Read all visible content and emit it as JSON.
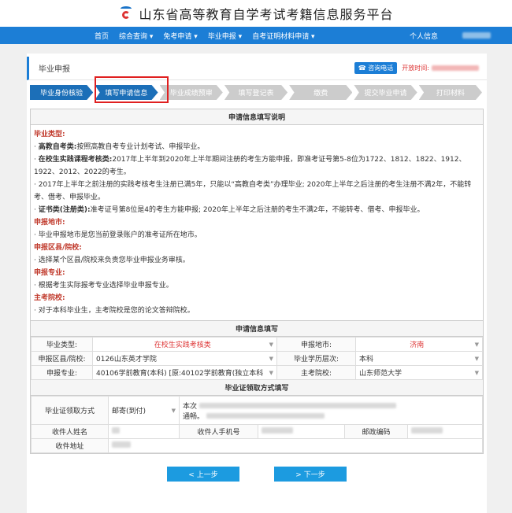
{
  "site": {
    "title": "山东省高等教育自学考试考籍信息服务平台"
  },
  "nav": {
    "items": [
      "首页",
      "综合查询 ▾",
      "免考申请 ▾",
      "毕业申报 ▾",
      "自考证明材料申请 ▾"
    ],
    "personal": "个人信息"
  },
  "breadcrumb": {
    "title": "毕业申报",
    "phone_label": "咨询电话",
    "open_label": "开放时间:"
  },
  "steps": [
    "毕业身份核验",
    "填写申请信息",
    "毕业成绩预审",
    "填写登记表",
    "缴费",
    "提交毕业申请",
    "打印材料"
  ],
  "instructions": {
    "title": "申请信息填写说明",
    "type_heading": "毕业类型:",
    "self_exam_label": "高教自考类:",
    "self_exam_text": "按照高教自考专业计划考试、申报毕业。",
    "inschool_label": "在校生实践课程考核类:",
    "inschool_text": "2017年上半年到2020年上半年期间注册的考生方能申报，即准考证号第5-8位为1722、1812、1822、1912、1922、2012、2022的考生。",
    "note_text": "· 2017年上半年之前注册的实践考核考生注册已满5年，只能以“高教自考类”办理毕业; 2020年上半年之后注册的考生注册不满2年，不能转考、借考、申报毕业。",
    "cert_label": "证书类(注册类):",
    "cert_text": "准考证号第8位是4的考生方能申报; 2020年上半年之后注册的考生不满2年，不能转考、借考、申报毕业。",
    "city_heading": "申报地市:",
    "city_text": "· 毕业申报地市是您当前登录账户的准考证所在地市。",
    "district_heading": "申报区县/院校:",
    "district_text": "· 选择某个区县/院校来负责您毕业申报业务审核。",
    "major_heading": "申报专业:",
    "major_text": "· 根据考生实际报考专业选择毕业申报专业。",
    "uni_heading": "主考院校:",
    "uni_text": "· 对于本科毕业生，主考院校是您的论文答辩院校。"
  },
  "form": {
    "title": "申请信息填写",
    "type_label": "毕业类型:",
    "type_value": "在校生实践考核类",
    "city_label": "申报地市:",
    "city_value": "济南",
    "district_label": "申报区县/院校:",
    "district_value": "0126山东英才学院",
    "level_label": "毕业学历层次:",
    "level_value": "本科",
    "major_label": "申报专业:",
    "major_value": "40106学前教育(本科) [原:40102学前教育(独立本科",
    "uni_label": "主考院校:",
    "uni_value": "山东师范大学"
  },
  "delivery": {
    "title": "毕业证领取方式填写",
    "method_label": "毕业证领取方式",
    "method_value": "邮寄(到付)",
    "note_start": "本次",
    "note_end": "通畅。",
    "name_label": "收件人姓名",
    "phone_label": "收件人手机号",
    "zip_label": "邮政编码",
    "addr_label": "收件地址"
  },
  "buttons": {
    "prev": "< 上一步",
    "next": "> 下一步"
  }
}
